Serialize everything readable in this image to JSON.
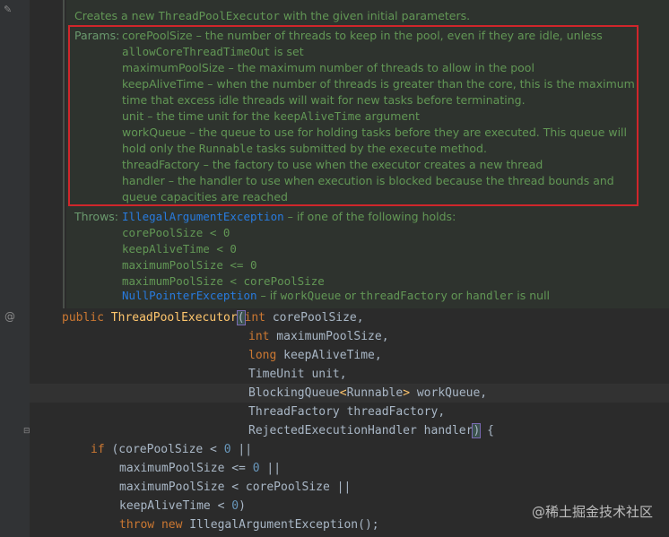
{
  "doc": {
    "intro_text": "Creates a new ",
    "intro_class": "ThreadPoolExecutor",
    "intro_rest": " with the given initial parameters.",
    "params_label": "Params:",
    "params": [
      {
        "t": "corePoolSize – the number of threads to keep in the pool, even if they are idle, unless"
      },
      {
        "code": "allowCoreThreadTimeOut",
        "t": " is set"
      },
      {
        "t": "maximumPoolSize – the maximum number of threads to allow in the pool"
      },
      {
        "t": "keepAliveTime – when the number of threads is greater than the core, this is the maximum"
      },
      {
        "t": "time that excess idle threads will wait for new tasks before terminating."
      },
      {
        "t": "unit – the time unit for the ",
        "code": "keepAliveTime",
        "t2": " argument"
      },
      {
        "t": "workQueue – the queue to use for holding tasks before they are executed. This queue will"
      },
      {
        "t": "hold only the ",
        "code": "Runnable",
        "t2": " tasks submitted by the ",
        "code2": "execute",
        "t3": " method."
      },
      {
        "t": "threadFactory – the factory to use when the executor creates a new thread"
      },
      {
        "t": "handler – the handler to use when execution is blocked because the thread bounds and"
      },
      {
        "t": "queue capacities are reached"
      }
    ],
    "throws_label": "Throws:",
    "throws_exc": "IllegalArgumentException",
    "throws_text": " – if one of the following holds:",
    "throws_conditions": [
      "corePoolSize < 0",
      "keepAliveTime < 0",
      "maximumPoolSize <= 0",
      "maximumPoolSize < corePoolSize"
    ],
    "npe": "NullPointerException",
    "npe_t1": " – if ",
    "npe_c1": "workQueue",
    "npe_t2": " or ",
    "npe_c2": "threadFactory",
    "npe_t3": " or ",
    "npe_c3": "handler",
    "npe_t4": " is null"
  },
  "code": {
    "public": "public ",
    "ctor": "ThreadPoolExecutor",
    "p1_type": "int",
    "p1_name": " corePoolSize,",
    "p2_type": "int",
    "p2_name": " maximumPoolSize,",
    "p3_type": "long",
    "p3_name": " keepAliveTime,",
    "p4": "TimeUnit unit,",
    "p5a": "BlockingQueue",
    "p5b": "<",
    "p5c": "Runnable",
    "p5d": ">",
    "p5e": " workQueue,",
    "p6": "ThreadFactory threadFactory,",
    "p7": "RejectedExecutionHandler handler",
    "brace": " {",
    "if_kw": "if",
    "if_rest": " (corePoolSize < ",
    "zero": "0",
    "or": " ||",
    "c2": "maximumPoolSize <= ",
    "c3": "maximumPoolSize < corePoolSize ||",
    "c4a": "keepAliveTime < ",
    "c4b": ")",
    "throw_kw": "throw",
    "new_kw": " new",
    "throw_rest": " IllegalArgumentException();"
  },
  "gutter": {
    "annotation_icon": "@",
    "edit_icon": "pencil-icon"
  },
  "watermark": "@稀土掘金技术社区",
  "colors": {
    "background": "#2b2b2b",
    "doc_text": "#629755",
    "keyword": "#cc7832",
    "method": "#ffc66d",
    "number": "#6897bb",
    "link": "#287bde",
    "highlight_box": "#d0262b"
  }
}
